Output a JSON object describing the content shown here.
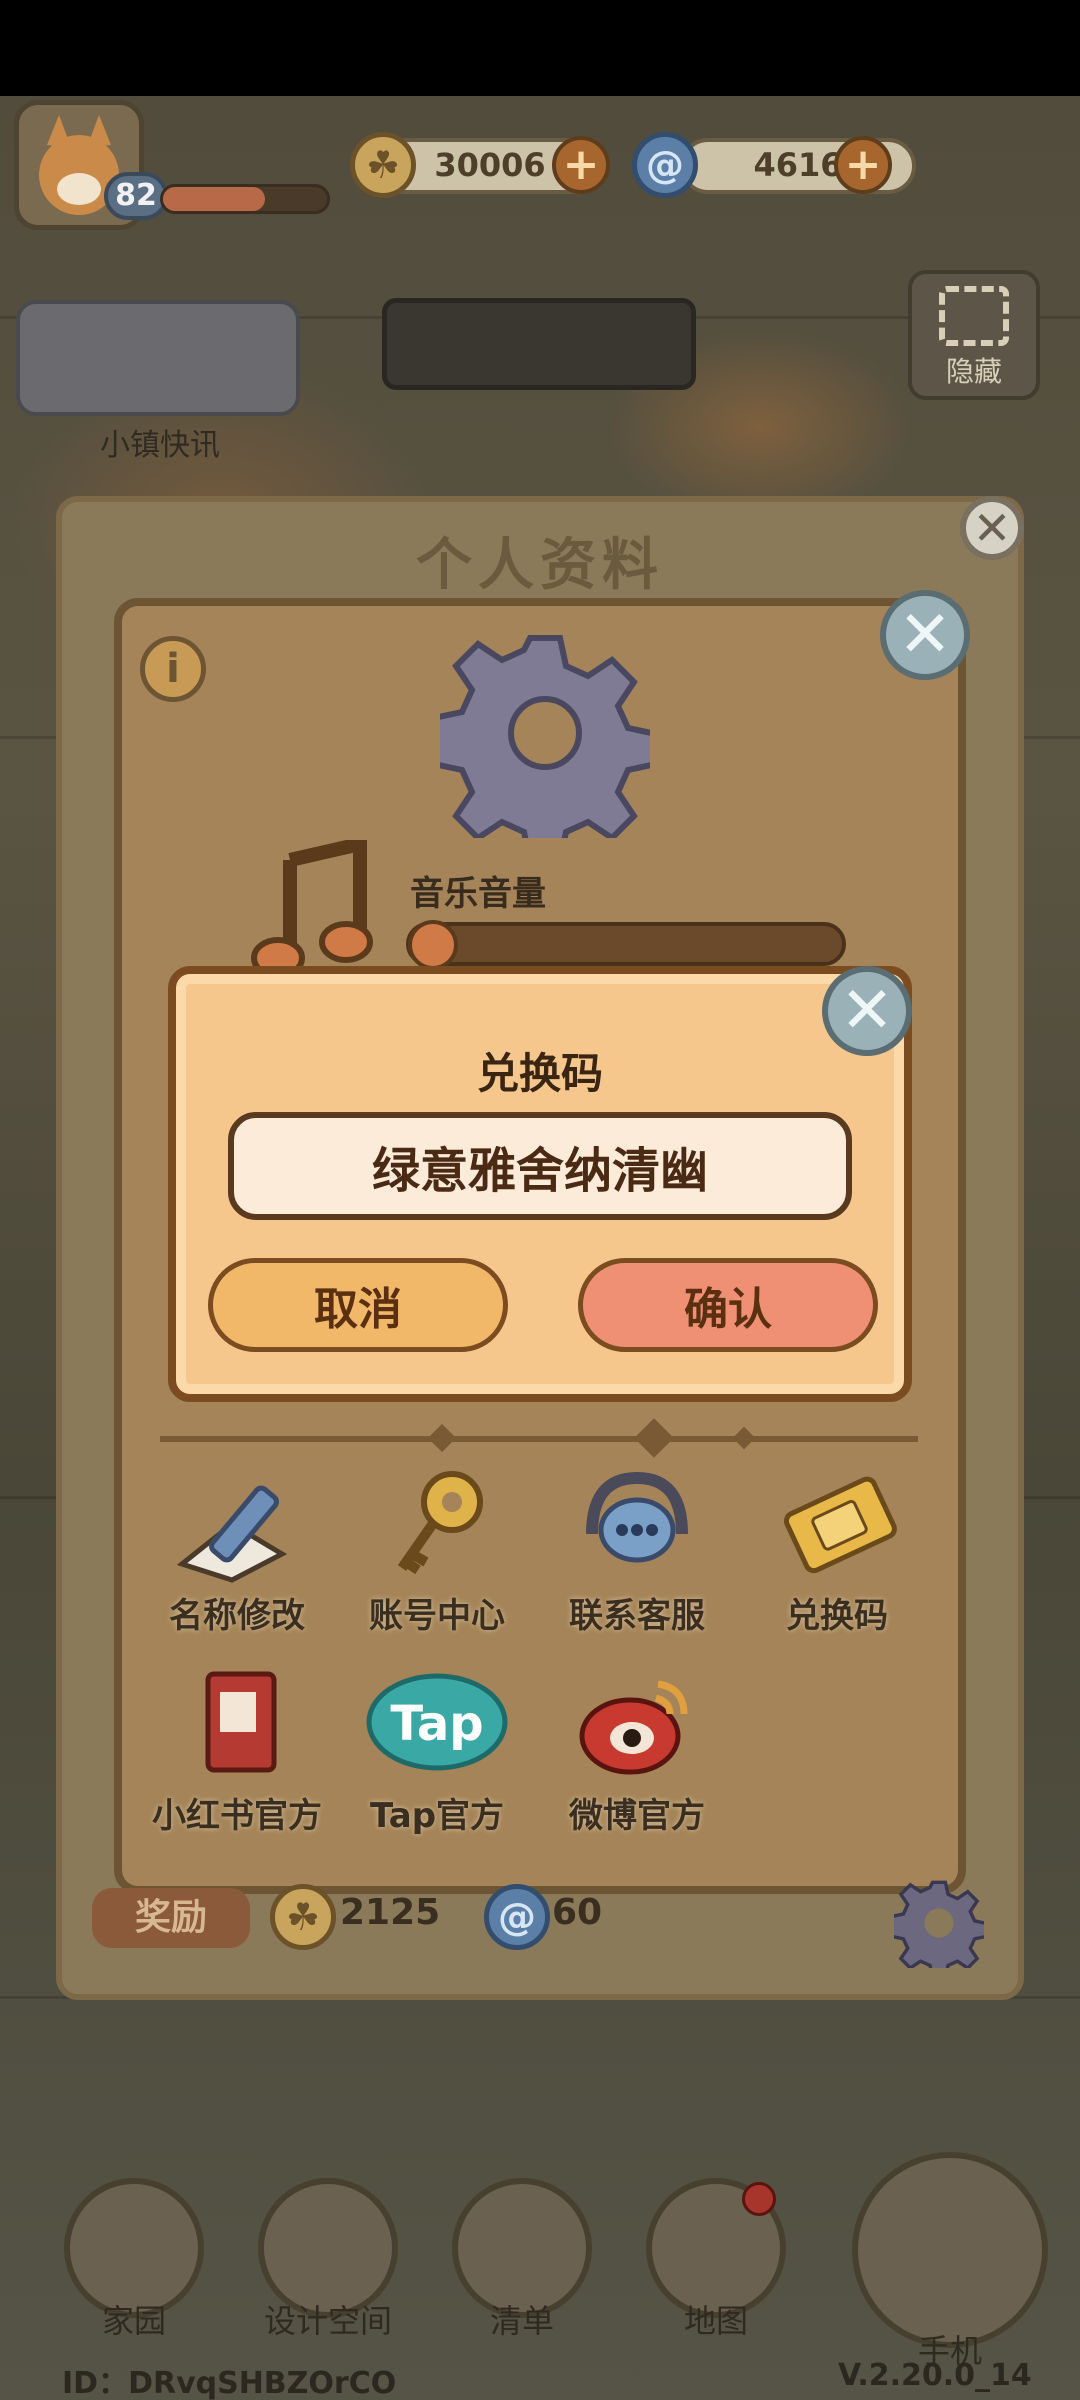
{
  "hud": {
    "level": "82",
    "coins": "30006",
    "gems": "4616",
    "hide_label": "隐藏",
    "news_label": "小镇快讯"
  },
  "panel": {
    "title": "个人资料",
    "music_volume_label": "音乐音量",
    "music_volume_level": 0.06,
    "grid": [
      {
        "label": "名称修改",
        "icon": "pencil-icon"
      },
      {
        "label": "账号中心",
        "icon": "key-icon"
      },
      {
        "label": "联系客服",
        "icon": "headset-icon"
      },
      {
        "label": "兑换码",
        "icon": "ticket-icon"
      },
      {
        "label": "小红书官方",
        "icon": "book-icon"
      },
      {
        "label": "Tap官方",
        "icon": "tap-icon"
      },
      {
        "label": "微博官方",
        "icon": "weibo-icon"
      }
    ],
    "reward_label": "奖励",
    "reward_coins": "2125",
    "reward_gems": "60"
  },
  "dialog": {
    "title": "兑换码",
    "input_value": "绿意雅舍纳清幽",
    "cancel_label": "取消",
    "confirm_label": "确认"
  },
  "bottom_nav": [
    {
      "label": "家园",
      "icon": "home-icon"
    },
    {
      "label": "设计空间",
      "icon": "design-icon"
    },
    {
      "label": "清单",
      "icon": "checklist-icon"
    },
    {
      "label": "地图",
      "icon": "map-pin-icon"
    },
    {
      "label": "手机",
      "icon": "phone-icon"
    }
  ],
  "footer": {
    "id_text": "ID：DRvqSHBZOrCO",
    "version": "V.2.20.0_14"
  },
  "colors": {
    "dialog_bg": "#f6c78d",
    "cancel_bg": "#f0b868",
    "confirm_bg": "#ef8f74",
    "panel_bg": "#a48458"
  }
}
